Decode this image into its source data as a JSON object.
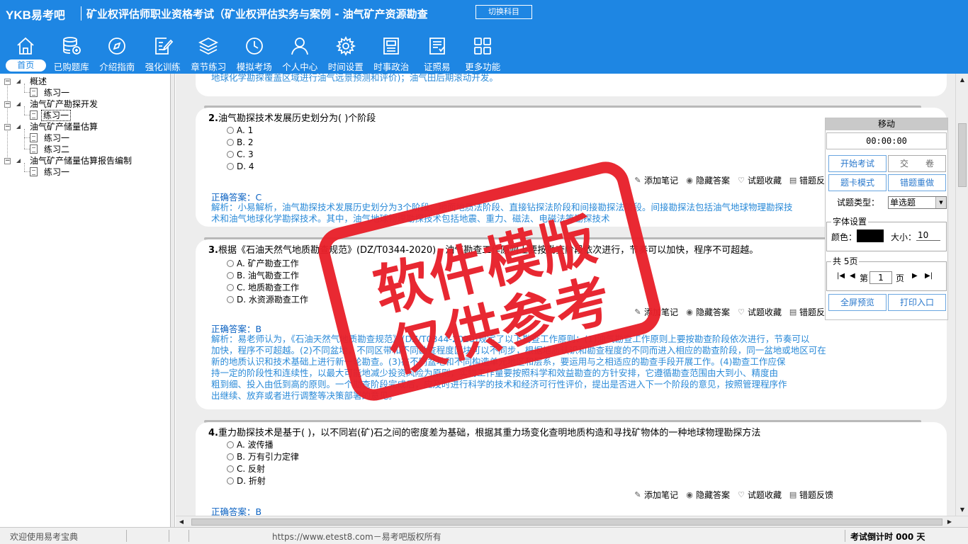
{
  "header": {
    "brand_ykb": "YKB",
    "brand_cn": "易考吧",
    "exam_title": "矿业权评估师职业资格考试（矿业权评估实务与案例 - 油气矿产资源勘查",
    "switch_label": "切换科目"
  },
  "nav": [
    {
      "label": "首页",
      "icon": "home-icon"
    },
    {
      "label": "已购题库",
      "icon": "database-icon"
    },
    {
      "label": "介绍指南",
      "icon": "compass-icon"
    },
    {
      "label": "强化训练",
      "icon": "edit-icon"
    },
    {
      "label": "章节练习",
      "icon": "layers-icon"
    },
    {
      "label": "模拟考场",
      "icon": "clock-icon"
    },
    {
      "label": "个人中心",
      "icon": "user-icon"
    },
    {
      "label": "时间设置",
      "icon": "gear-icon"
    },
    {
      "label": "时事政治",
      "icon": "news-icon"
    },
    {
      "label": "证照易",
      "icon": "certificate-icon"
    },
    {
      "label": "更多功能",
      "icon": "grid-icon"
    }
  ],
  "tree": {
    "items": [
      {
        "label": "概述",
        "level": 0
      },
      {
        "label": "练习一",
        "level": 1
      },
      {
        "label": "油气矿产勘探开发",
        "level": 0
      },
      {
        "label": "练习一",
        "level": 1,
        "selected": true
      },
      {
        "label": "油气矿产储量估算",
        "level": 0
      },
      {
        "label": "练习一",
        "level": 1
      },
      {
        "label": "练习二",
        "level": 1
      },
      {
        "label": "油气矿产储量估算报告编制",
        "level": 0
      },
      {
        "label": "练习一",
        "level": 1
      }
    ]
  },
  "questions": {
    "q1_tail": "地球化学勘探覆盖区域进行油气远景预测和评价)；油气田后期滚动开发。",
    "q2": {
      "num": "2.",
      "text": "油气勘探技术发展历史划分为( )个阶段",
      "options": [
        "A. 1",
        "B. 2",
        "C. 3",
        "D. 4"
      ],
      "answer": "正确答案：C",
      "analysis_l1": "解析：小易解析，油气勘探技术发展历史划分为3个阶段：地面地质法阶段、直接钻探法阶段和间接勘探法阶段。间接勘探法包括油气地球物理勘探技",
      "analysis_l2": "术和油气地球化学勘探技术。其中，油气地球物理勘探技术包括地震、重力、磁法、电磁法等勘探技术"
    },
    "q3": {
      "num": "3.",
      "text": "根据《石油天然气地质勘查规范》(DZ/T0344-2020)，油气勘查工作原则上要按勘查阶段依次进行，节奏可以加快，程序不可超越。",
      "options": [
        "A. 矿产勘查工作",
        "B. 油气勘查工作",
        "C. 地质勘查工作",
        "D. 水资源勘查工作"
      ],
      "answer": "正确答案：B",
      "analysis": [
        "解析：易老师认为，《石油天然气地质勘查规范》(DZ/T0344-2020)规定了以下勘查工作原则：(1)油气勘查工作原则上要按勘查阶段依次进行，节奏可以",
        "加快，程序不可超越。(2)不同盆地，不同区带和不同勘查程度区块可以不同步，根据地质认识和勘查程度的不同而进入相应的勘查阶段，同一盆地或地区可在",
        "新的地质认识和技术基础上进行新一轮勘查。(3)在不同盆地和不同构造单元地区和层系，要运用与之相适应的勘查手段开展工作。(4)勘查工作应保",
        "持一定的阶段性和连续性，以最大可能地减少投资风险为原则，实物工作量要按照科学和效益勘查的方针安排，它遵循勘查范围由大到小、精度由",
        "粗到细、投入由低到高的原则。一个勘查阶段完成后，应及时进行科学的技术和经济可行性评价，提出是否进入下一个阶段的意见，按照管理程序作",
        "出继续、放弃或者进行调整等决策部署的意见。"
      ]
    },
    "q4": {
      "num": "4.",
      "text": "重力勘探技术是基于( )，以不同岩(矿)石之间的密度差为基础，根据其重力场变化查明地质构造和寻找矿物体的一种地球物理勘探方法",
      "options": [
        "A. 波传播",
        "B. 万有引力定律",
        "C. 反射",
        "D. 折射"
      ],
      "answer": "正确答案：B"
    }
  },
  "actions": {
    "add_note": "添加笔记",
    "hide_answer": "隐藏答案",
    "favorite": "试题收藏",
    "feedback": "错题反馈"
  },
  "panel": {
    "title": "移动",
    "timer": "00:00:00",
    "start_exam": "开始考试",
    "submit": "交　　卷",
    "card_mode": "题卡模式",
    "redo_wrong": "错题重做",
    "type_label": "试题类型：",
    "type_value": "单选题",
    "font_legend": "字体设置",
    "color_label": "颜色：",
    "size_label": "大小：",
    "size_value": "10",
    "color_value": "#000000",
    "pages_legend": "共 5页",
    "page_prefix": "第",
    "page_value": "1",
    "page_suffix": "页",
    "fullscreen": "全屏预览",
    "print": "打印入口"
  },
  "stamp": {
    "line1": "软件模版",
    "line2": "仅供参考"
  },
  "status": {
    "welcome": "欢迎使用易考宝典",
    "copyright": "https://www.etest8.com－易考吧版权所有",
    "countdown": "考试倒计时 000 天"
  },
  "colors": {
    "brand_blue": "#1e86e3",
    "answer_blue": "#0b62c2",
    "analysis_blue": "#2a8ad8",
    "stamp_red": "#e8202a"
  }
}
